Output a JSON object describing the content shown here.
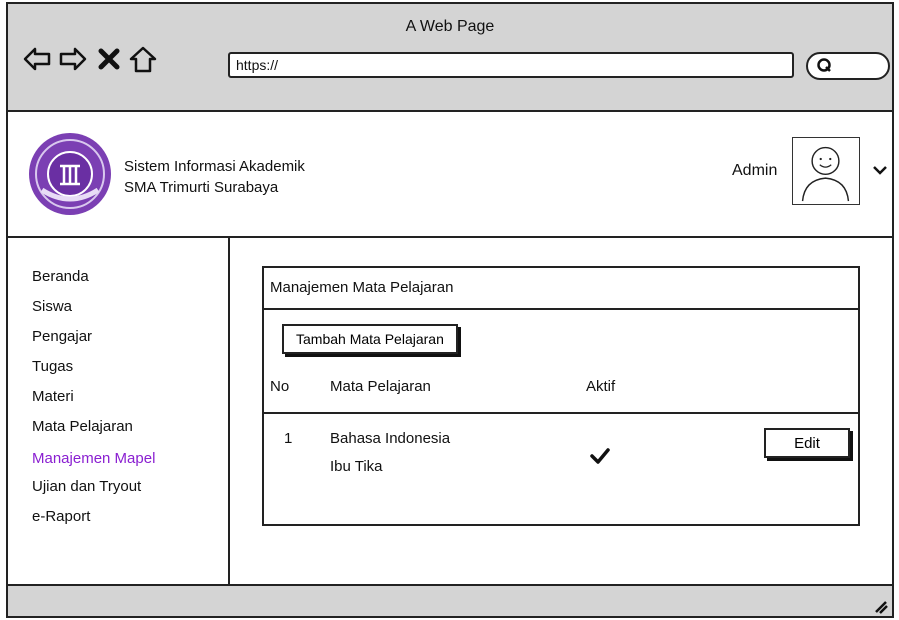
{
  "browser": {
    "title": "A Web Page",
    "url": "https://",
    "icons": [
      "back-arrow-icon",
      "forward-arrow-icon",
      "close-x-icon",
      "home-icon",
      "search-icon"
    ]
  },
  "header": {
    "app_name_line1": "Sistem Informasi Akademik",
    "app_name_line2": "SMA Trimurti Surabaya",
    "user_label": "Admin",
    "logo_icon": "school-crest-icon",
    "avatar_icon": "user-avatar-icon",
    "menu_icon": "chevron-down-icon"
  },
  "sidebar": {
    "items": [
      {
        "label": "Beranda"
      },
      {
        "label": "Siswa"
      },
      {
        "label": "Pengajar"
      },
      {
        "label": "Tugas"
      },
      {
        "label": "Materi"
      },
      {
        "label": "Mata Pelajaran"
      },
      {
        "label": "Manajemen Mapel"
      },
      {
        "label": "Ujian dan Tryout"
      },
      {
        "label": "e-Raport"
      }
    ],
    "active_color": "#8a1fd1"
  },
  "main": {
    "panel_title": "Manajemen Mata Pelajaran",
    "add_button": "Tambah Mata Pelajaran",
    "columns": [
      "No",
      "Mata Pelajaran",
      "Aktif"
    ],
    "rows": [
      {
        "no": "1",
        "subject": "Bahasa Indonesia",
        "teacher": "Ibu Tika",
        "active_icon": "checkmark-icon",
        "action": "Edit"
      }
    ]
  },
  "colors": {
    "chrome": "#d4d4d4",
    "logo_purple": "#7b3fb3"
  }
}
